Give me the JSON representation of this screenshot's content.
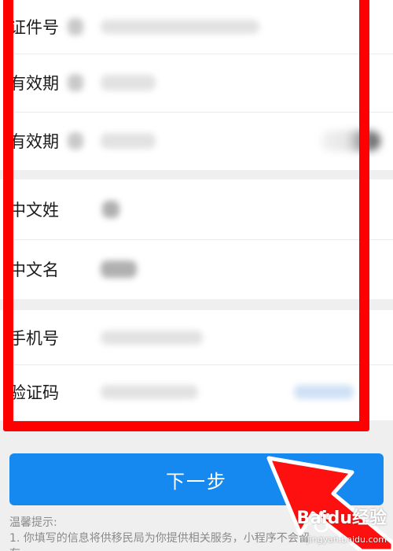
{
  "form": {
    "group1": [
      {
        "label": "证件号"
      },
      {
        "label": "有效期"
      },
      {
        "label": "有效期"
      }
    ],
    "group2": [
      {
        "label": "中文姓"
      },
      {
        "label": "中文名"
      }
    ],
    "group3": [
      {
        "label": "手机号"
      },
      {
        "label": "验证码"
      }
    ]
  },
  "actions": {
    "next_label": "下一步"
  },
  "tips": {
    "title": "温馨提示:",
    "line1": "1. 你填写的信息将供移民局为你提供相关服务，小程序不会留",
    "line2": "存"
  },
  "watermark": {
    "text": "Baidu经验",
    "url": "jingyan.baidu.com"
  },
  "colors": {
    "primary_button": "#1589f0",
    "annotation_red": "#ff0000",
    "background": "#efefef"
  }
}
